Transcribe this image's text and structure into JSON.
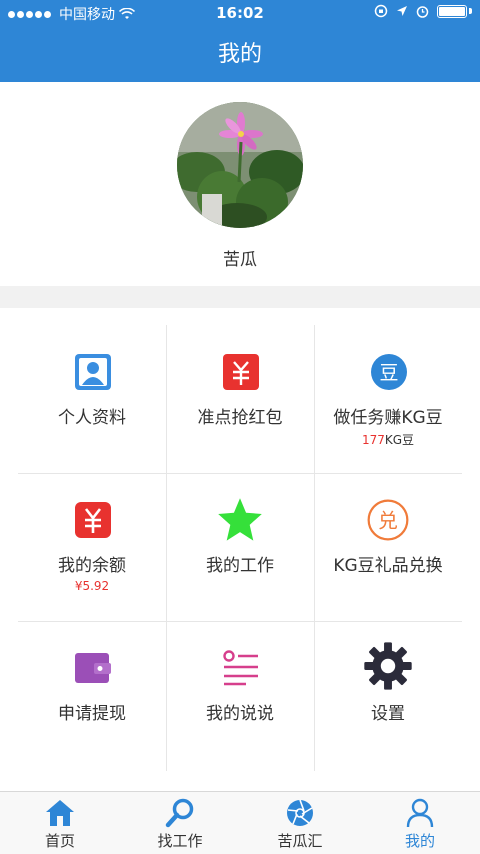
{
  "status_bar": {
    "carrier": "中国移动",
    "time": "16:02"
  },
  "header": {
    "title": "我的"
  },
  "profile": {
    "name": "苦瓜"
  },
  "menu": [
    {
      "label": "个人资料",
      "icon": "profile-card-icon",
      "color": "#3a8ee0"
    },
    {
      "label": "准点抢红包",
      "icon": "red-envelope-icon",
      "color": "#e8322f"
    },
    {
      "label": "做任务赚KG豆",
      "icon": "kg-bean-icon",
      "color": "#2e86d6",
      "sub_value": "177",
      "sub_unit": "KG豆"
    },
    {
      "label": "我的余额",
      "icon": "wallet-yen-icon",
      "color": "#e8322f",
      "sub": "¥5.92"
    },
    {
      "label": "我的工作",
      "icon": "star-icon",
      "color": "#35e03a"
    },
    {
      "label": "KG豆礼品兑换",
      "icon": "exchange-icon",
      "color": "#f07b3a"
    },
    {
      "label": "申请提现",
      "icon": "purse-icon",
      "color": "#9b4fb7"
    },
    {
      "label": "我的说说",
      "icon": "list-text-icon",
      "color": "#d63f8c"
    },
    {
      "label": "设置",
      "icon": "gear-icon",
      "color": "#2b2b3a"
    }
  ],
  "tabs": [
    {
      "label": "首页",
      "icon": "home-icon"
    },
    {
      "label": "找工作",
      "icon": "search-icon"
    },
    {
      "label": "苦瓜汇",
      "icon": "aperture-icon"
    },
    {
      "label": "我的",
      "icon": "user-icon",
      "active": true
    }
  ],
  "colors": {
    "primary": "#2e86d6",
    "accent_red": "#e8322f"
  }
}
